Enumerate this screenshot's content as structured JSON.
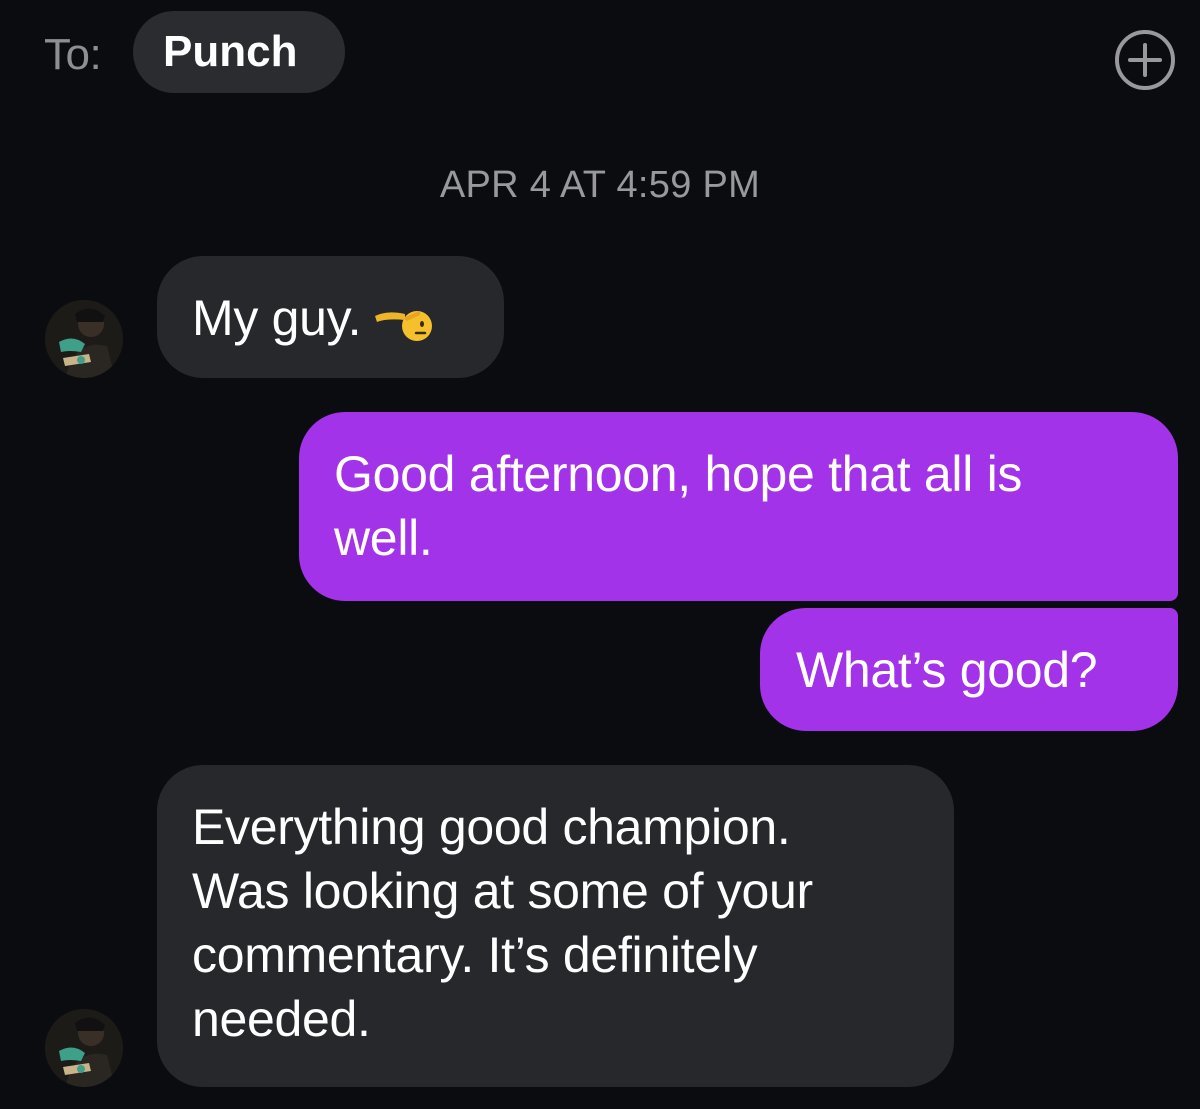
{
  "header": {
    "to_label": "To:",
    "recipient": "Punch",
    "add_icon": "plus-circle-icon"
  },
  "timestamp": "APR 4 AT 4:59 PM",
  "messages": [
    {
      "direction": "incoming",
      "lines": [
        "My guy."
      ],
      "emoji": "saluting-face"
    },
    {
      "direction": "outgoing",
      "lines": [
        "Good afternoon, hope that all is",
        "well."
      ]
    },
    {
      "direction": "outgoing",
      "lines": [
        "What’s good?"
      ]
    },
    {
      "direction": "incoming",
      "lines": [
        "Everything good champion.",
        "Was looking at some of your",
        "commentary. It’s definitely",
        "needed."
      ]
    }
  ],
  "colors": {
    "background": "#0b0c10",
    "incoming_bubble": "#26282c",
    "outgoing_bubble": "#a233e8",
    "muted_text": "#8e8e93"
  }
}
